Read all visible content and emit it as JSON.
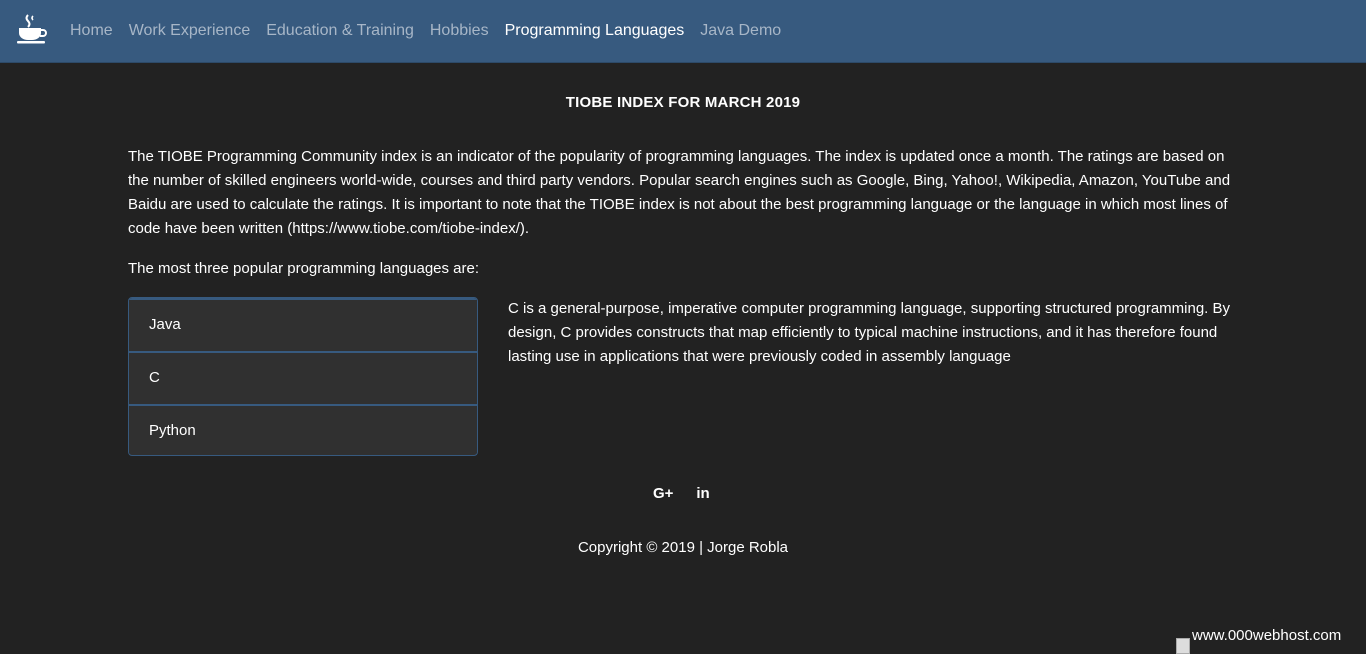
{
  "nav": {
    "brand_icon": "coffee-cup-icon",
    "items": [
      {
        "label": "Home",
        "active": false
      },
      {
        "label": "Work Experience",
        "active": false
      },
      {
        "label": "Education & Training",
        "active": false
      },
      {
        "label": "Hobbies",
        "active": false
      },
      {
        "label": "Programming Languages",
        "active": true
      },
      {
        "label": "Java Demo",
        "active": false
      }
    ]
  },
  "main": {
    "title": "TIOBE INDEX FOR MARCH 2019",
    "intro": "The TIOBE Programming Community index is an indicator of the popularity of programming languages. The index is updated once a month. The ratings are based on the number of skilled engineers world-wide, courses and third party vendors. Popular search engines such as Google, Bing, Yahoo!, Wikipedia, Amazon, YouTube and Baidu are used to calculate the ratings. It is important to note that the TIOBE index is not about the best programming language or the language in which most lines of code have been written (https://www.tiobe.com/tiobe-index/).",
    "lead": "The most three popular programming languages are:",
    "languages": [
      "Java",
      "C",
      "Python"
    ],
    "description": "C is a general-purpose, imperative computer programming language, supporting structured programming. By design, C provides constructs that map efficiently to typical machine instructions, and it has therefore found lasting use in applications that were previously coded in assembly language"
  },
  "footer": {
    "social": [
      {
        "icon": "google-plus-icon",
        "label": "G+"
      },
      {
        "icon": "linkedin-icon",
        "label": "in"
      }
    ],
    "copyright": "Copyright © 2019 | Jorge Robla"
  },
  "host_badge": "www.000webhost.com",
  "colors": {
    "navbar": "#375a7f",
    "background": "#222222",
    "list_item": "#303030",
    "nav_inactive": "#a7b6c7"
  }
}
